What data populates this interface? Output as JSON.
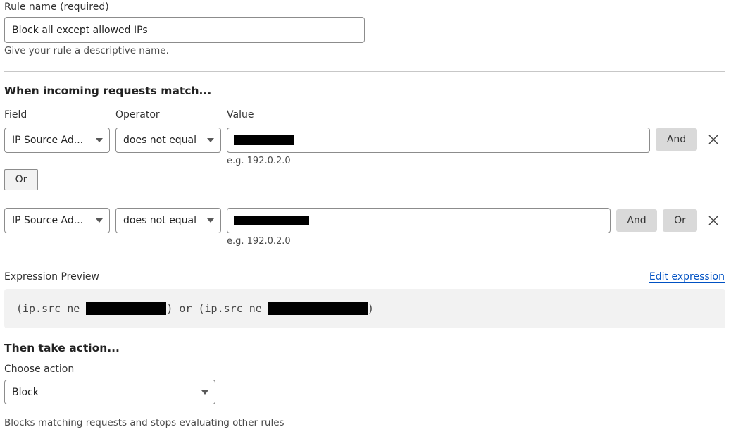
{
  "rule_name": {
    "label": "Rule name (required)",
    "value": "Block all except allowed IPs",
    "help": "Give your rule a descriptive name."
  },
  "match_section": {
    "heading": "When incoming requests match...",
    "columns": {
      "field": "Field",
      "operator": "Operator",
      "value": "Value"
    },
    "groups": [
      {
        "field": "IP Source Ad...",
        "operator": "does not equal",
        "value": "[redacted]",
        "value_hint": "e.g. 192.0.2.0",
        "buttons": [
          "And"
        ]
      },
      {
        "field": "IP Source Ad...",
        "operator": "does not equal",
        "value": "[redacted]",
        "value_hint": "e.g. 192.0.2.0",
        "buttons": [
          "And",
          "Or"
        ]
      }
    ],
    "or_button": "Or"
  },
  "expression": {
    "label": "Expression Preview",
    "edit_link": "Edit expression",
    "part1_prefix": "(ip.src ne ",
    "part1_suffix": ") or (ip.src ne ",
    "part2_suffix": ")"
  },
  "action_section": {
    "heading": "Then take action...",
    "label": "Choose action",
    "selected": "Block",
    "description": "Blocks matching requests and stops evaluating other rules"
  },
  "icons": {
    "close": "close-icon",
    "dropdown": "caret-down-icon"
  },
  "colors": {
    "link": "#0051c3",
    "button_gray": "#d9d9d9",
    "expression_bg": "#f2f2f2"
  }
}
